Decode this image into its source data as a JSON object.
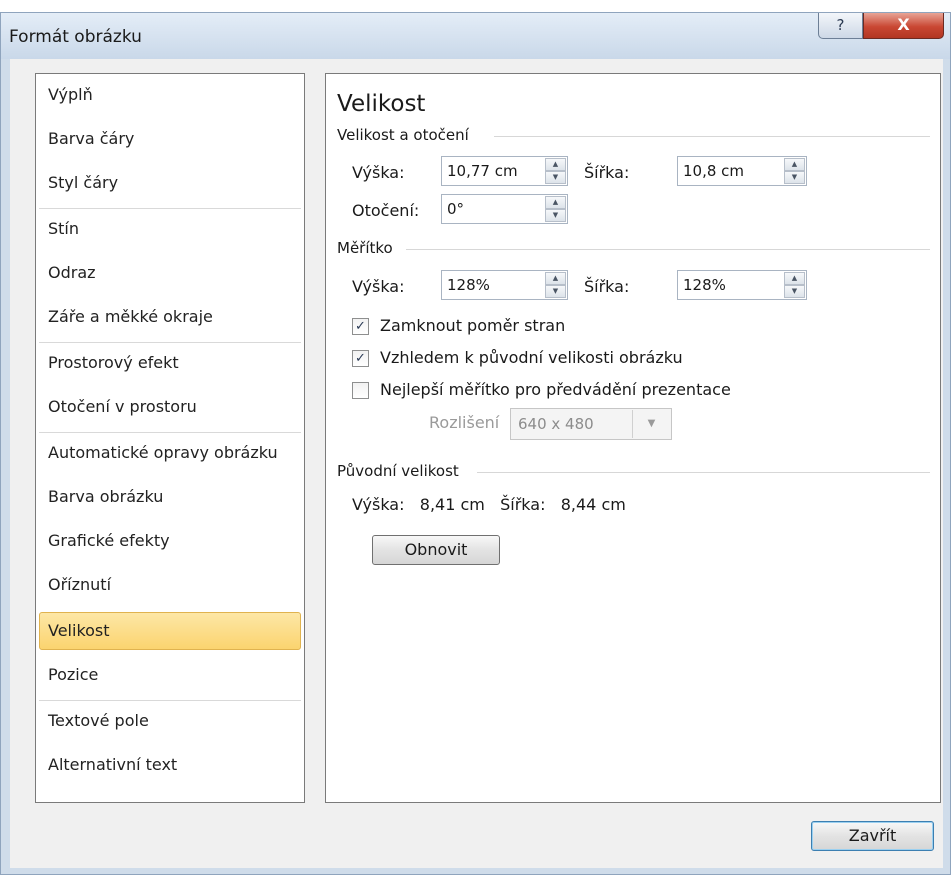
{
  "window": {
    "title": "Formát obrázku",
    "help_glyph": "?",
    "close_glyph": "X"
  },
  "sidebar": {
    "items": [
      {
        "label": "Výplň"
      },
      {
        "label": "Barva čáry"
      },
      {
        "label": "Styl čáry"
      },
      {
        "label": "Stín"
      },
      {
        "label": "Odraz"
      },
      {
        "label": "Záře a měkké okraje"
      },
      {
        "label": "Prostorový efekt"
      },
      {
        "label": "Otočení v prostoru"
      },
      {
        "label": "Automatické opravy obrázku"
      },
      {
        "label": "Barva obrázku"
      },
      {
        "label": "Grafické efekty"
      },
      {
        "label": "Oříznutí"
      },
      {
        "label": "Velikost",
        "selected": true
      },
      {
        "label": "Pozice"
      },
      {
        "label": "Textové pole"
      },
      {
        "label": "Alternativní text"
      }
    ]
  },
  "panel": {
    "title": "Velikost",
    "size_rotation": {
      "heading": "Velikost a otočení",
      "height_label": "Výška:",
      "height_value": "10,77 cm",
      "width_label": "Šířka:",
      "width_value": "10,8 cm",
      "rotation_label": "Otočení:",
      "rotation_value": "0°"
    },
    "scale": {
      "heading": "Měřítko",
      "height_label": "Výška:",
      "height_value": "128%",
      "width_label": "Šířka:",
      "width_value": "128%",
      "lock_aspect_label": "Zamknout poměr stran",
      "lock_aspect_checked": true,
      "relative_label": "Vzhledem k původní velikosti obrázku",
      "relative_checked": true,
      "best_scale_label": "Nejlepší měřítko pro předvádění prezentace",
      "best_scale_checked": false,
      "resolution_label": "Rozlišení",
      "resolution_value": "640 x 480"
    },
    "original": {
      "heading": "Původní velikost",
      "text": "Výška:   8,41 cm   Šířka:   8,44 cm",
      "reset_label": "Obnovit"
    }
  },
  "footer": {
    "close_label": "Zavřít"
  },
  "colors": {
    "selected_item": "#fbd46f",
    "close_button": "#c94733",
    "accent_border": "#3c7fb1"
  }
}
